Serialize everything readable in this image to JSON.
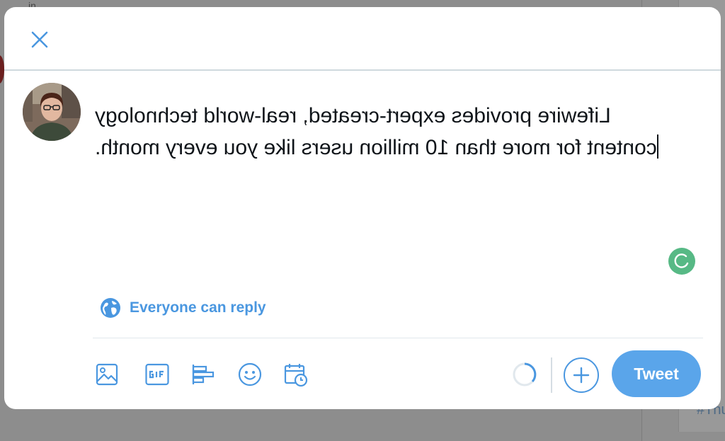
{
  "composer": {
    "tweet_text_lines": [
      "Lifewire provides expert-created, real-world technology",
      "content for more than 10 million users like you every month."
    ],
    "reply_setting_label": "Everyone can reply",
    "tweet_button_label": "Tweet",
    "text_direction": "mirrored"
  },
  "background": {
    "right_panel_hashtag": "#Thu"
  },
  "colors": {
    "accent": "#4a97e0",
    "tweet_button": "#5aa5ea",
    "grammar_badge": "#57b985",
    "overlay": "#8d8d8d"
  },
  "icons": {
    "close": "close-icon",
    "reply": "globe-icon",
    "media": "image-icon",
    "gif": "gif-icon",
    "poll": "poll-icon",
    "emoji": "emoji-icon",
    "schedule": "schedule-icon",
    "add": "plus-icon",
    "grammar": "grammarly-icon",
    "progress": "character-count-ring"
  }
}
